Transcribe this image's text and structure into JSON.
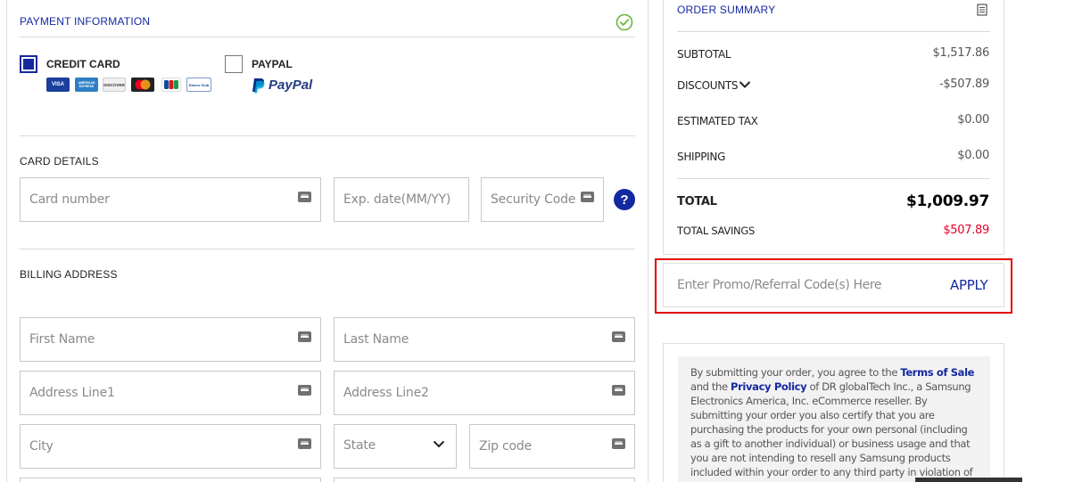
{
  "payment": {
    "title": "PAYMENT INFORMATION",
    "options": [
      {
        "label": "CREDIT CARD",
        "checked": true
      },
      {
        "label": "PAYPAL",
        "checked": false
      }
    ],
    "paypal_logo_text": "PayPal",
    "card_brands": [
      "VISA",
      "AMERICAN EXPRESS",
      "DISCOVER",
      "MasterCard",
      "JCB",
      "Diners Club"
    ],
    "card_details_title": "CARD DETAILS",
    "card_fields": {
      "card_number": "Card number",
      "exp_date": "Exp. date(MM/YY)",
      "security_code": "Security Code"
    },
    "help_icon": "?",
    "billing_title": "BILLING ADDRESS",
    "billing_fields": {
      "first_name": "First Name",
      "last_name": "Last Name",
      "address1": "Address Line1",
      "address2": "Address Line2",
      "city": "City",
      "state": "State",
      "zip": "Zip code"
    }
  },
  "summary": {
    "title": "ORDER SUMMARY",
    "subtotal_label": "SUBTOTAL",
    "subtotal_value": "$1,517.86",
    "discounts_label": "DISCOUNTS",
    "discounts_value": "-$507.89",
    "tax_label": "ESTIMATED TAX",
    "tax_value": "$0.00",
    "shipping_label": "SHIPPING",
    "shipping_value": "$0.00",
    "total_label": "TOTAL",
    "total_value": "$1,009.97",
    "savings_label": "TOTAL SAVINGS",
    "savings_value": "$507.89"
  },
  "promo": {
    "placeholder": "Enter Promo/Referral Code(s) Here",
    "apply_label": "APPLY"
  },
  "terms": {
    "text_1": "By submitting your order, you agree to the ",
    "terms_link": "Terms of Sale",
    "text_2": " and the ",
    "privacy_link": "Privacy Policy",
    "text_3": " of DR globalTech Inc., a Samsung Electronics America, Inc. eCommerce reseller. By submitting your order you also certify that you are purchasing the products for your own personal (including as a gift to another individual) or business usage and that you are not intending to resell any Samsung products included within your order to any third party in violation of this store's"
  },
  "colors": {
    "brand_blue": "#1428a0",
    "highlight_red": "#e10000",
    "savings_red": "#e4002b",
    "success_green": "#6cb33f"
  },
  "icons": {
    "complete": "check-circle-icon",
    "summary": "receipt-icon",
    "keyboard": "keyboard-icon",
    "dropdown": "chevron-down-icon",
    "help": "help-icon"
  }
}
